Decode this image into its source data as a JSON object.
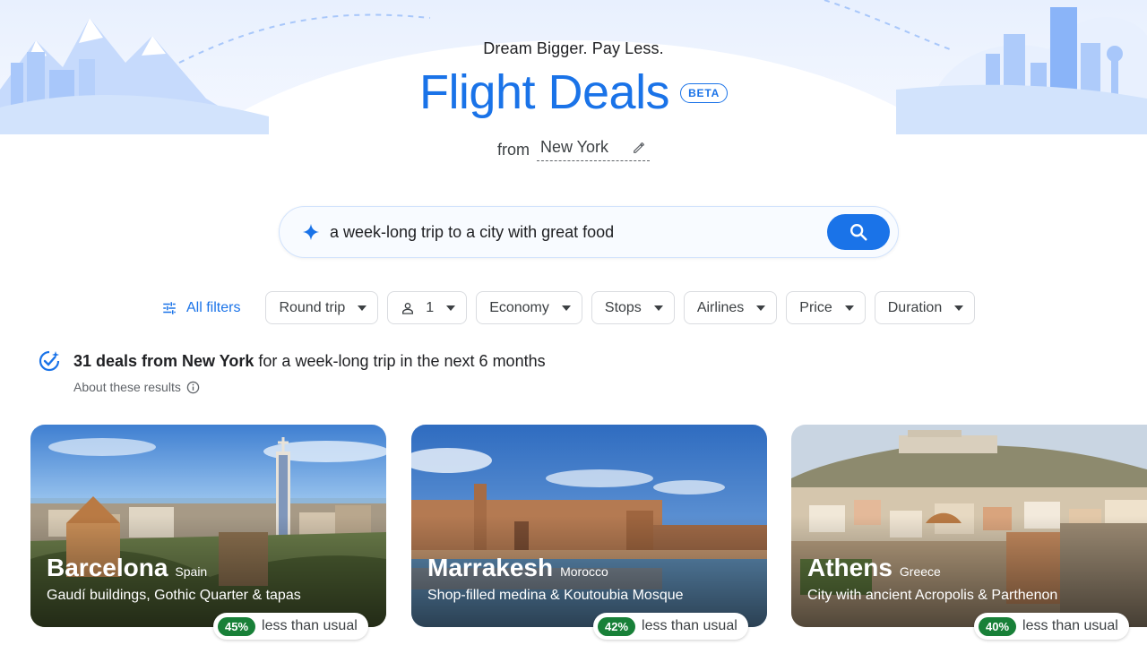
{
  "header": {
    "tagline": "Dream Bigger. Pay Less.",
    "title": "Flight Deals",
    "badge": "BETA",
    "from_label": "from",
    "from_city": "New York"
  },
  "search": {
    "query": "a week-long trip to a city with great food"
  },
  "filters": {
    "all_filters": "All filters",
    "trip_type": "Round trip",
    "passengers": "1",
    "cabin": "Economy",
    "stops": "Stops",
    "airlines": "Airlines",
    "price": "Price",
    "duration": "Duration"
  },
  "results": {
    "count_text": "31 deals from New York",
    "rest_text": "for a week-long trip in the next 6 months",
    "about": "About these results"
  },
  "deals": [
    {
      "city": "Barcelona",
      "country": "Spain",
      "description": "Gaudí buildings, Gothic Quarter & tapas",
      "discount": "45%",
      "discount_label": "less than usual"
    },
    {
      "city": "Marrakesh",
      "country": "Morocco",
      "description": "Shop-filled medina & Koutoubia Mosque",
      "discount": "42%",
      "discount_label": "less than usual"
    },
    {
      "city": "Athens",
      "country": "Greece",
      "description": "City with ancient Acropolis & Parthenon",
      "discount": "40%",
      "discount_label": "less than usual"
    }
  ],
  "colors": {
    "accent": "#1a73e8",
    "deal_badge": "#188038",
    "hero_tint": "#d2e3fc"
  }
}
